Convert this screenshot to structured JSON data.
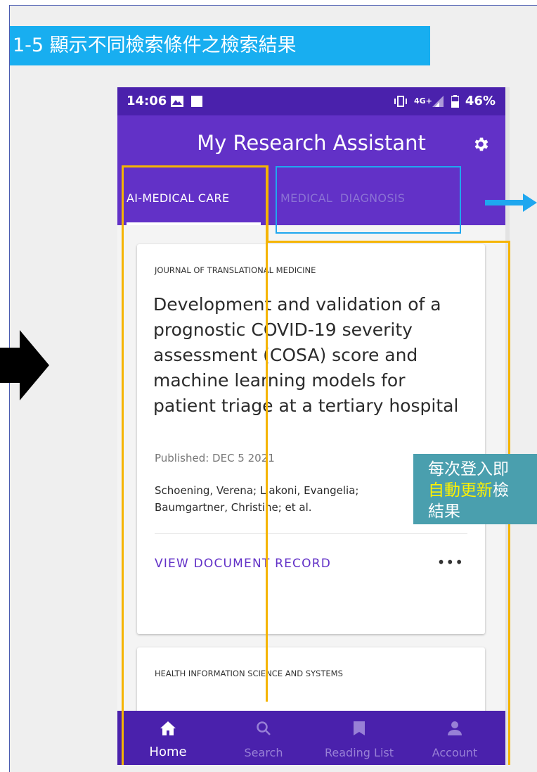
{
  "slide": {
    "title": "1-5 顯示不同檢索條件之檢索結果"
  },
  "status_bar": {
    "time": "14:06",
    "battery": "46%"
  },
  "app_bar": {
    "title": "My Research Assistant",
    "settings_icon": "gear-icon"
  },
  "tabs": [
    {
      "label": "AI-MEDICAL CARE",
      "selected": true
    },
    {
      "label": "MEDICAL  DIAGNOSIS",
      "selected": false
    }
  ],
  "cards": [
    {
      "journal": "JOURNAL OF TRANSLATIONAL MEDICINE",
      "title": "Development and validation of a prognostic COVID-19 severity assessment (COSA) score and machine learning models for patient triage at a tertiary hospital",
      "published": "Published: DEC 5 2021",
      "authors": "Schoening, Verena; Liakoni, Evangelia; Baumgartner, Christine; et al.",
      "action_label": "VIEW DOCUMENT RECORD",
      "more_label": "•••"
    },
    {
      "journal": "HEALTH INFORMATION SCIENCE AND SYSTEMS"
    }
  ],
  "bottom_nav": [
    {
      "label": "Home",
      "icon": "home-icon",
      "active": true
    },
    {
      "label": "Search",
      "icon": "search-icon",
      "active": false
    },
    {
      "label": "Reading List",
      "icon": "bookmark-icon",
      "active": false
    },
    {
      "label": "Account",
      "icon": "account-icon",
      "active": false
    }
  ],
  "annotation": {
    "line1": "每次登入即",
    "line2_highlight": "自動更新",
    "line2_rest": "檢",
    "line3": "結果"
  },
  "colors": {
    "accent": "#6231c7",
    "status_bar": "#4a21ac",
    "title_banner": "#18aef0",
    "annotation_box": "#f5b400",
    "callout": "#4a9fae"
  }
}
